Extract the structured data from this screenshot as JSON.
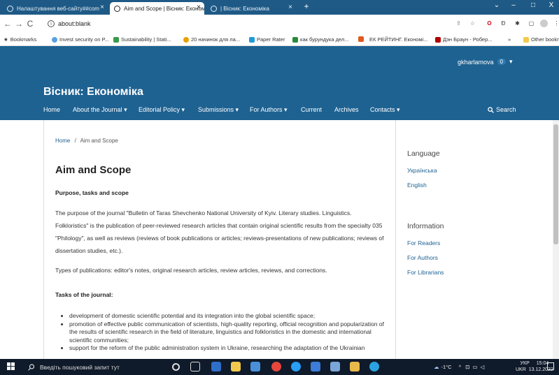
{
  "browser": {
    "tabs": [
      {
        "label": "Налаштування веб-сайту##com",
        "active": false
      },
      {
        "label": "Aim and Scope | Вісник: Економі",
        "active": true
      },
      {
        "label": "| Вісник: Економіка",
        "active": false
      }
    ],
    "new_tab": "+",
    "window_controls": {
      "minimize": "–",
      "maximize": "□",
      "close": "X"
    },
    "address": "about:blank",
    "bookmarks": [
      {
        "label": "Bookmarks",
        "color": "#1a73e8"
      },
      {
        "label": "Invest security on P...",
        "color": "#5aa0e0"
      },
      {
        "label": "Sustainability | Stati...",
        "color": "#3a9a4a"
      },
      {
        "label": "20 начинок для ла...",
        "color": "#e8a000"
      },
      {
        "label": "Paper Rater",
        "color": "#1e9bd7"
      },
      {
        "label": "как бурундука дел...",
        "color": "#2a8a3a"
      },
      {
        "label": "",
        "color": "#e05a20"
      },
      {
        "label": "ЕК РЕЙТИНГ. Економі...",
        "color": "#c0001f"
      },
      {
        "label": "Дэн Браун - Робер...",
        "color": "#b00000"
      }
    ],
    "bookmarks_more": "»",
    "other_bookmarks": "Other bookmarks"
  },
  "header": {
    "site_title": "Вісник: Економіка",
    "user": "gkharlamova",
    "notifications": "0",
    "nav": [
      {
        "label": "Home",
        "dropdown": false
      },
      {
        "label": "About the Journal",
        "dropdown": true
      },
      {
        "label": "Editorial Policy",
        "dropdown": true
      },
      {
        "label": "Submissions",
        "dropdown": true
      },
      {
        "label": "For Authors",
        "dropdown": true
      },
      {
        "label": "Current",
        "dropdown": false
      },
      {
        "label": "Archives",
        "dropdown": false
      },
      {
        "label": "Contacts",
        "dropdown": true
      }
    ],
    "search_label": "Search",
    "bg_color": "#1e6292"
  },
  "main": {
    "breadcrumb": {
      "home": "Home",
      "separator": "/",
      "current": "Aim and Scope"
    },
    "title": "Aim and Scope",
    "subtitle": "Purpose, tasks and scope",
    "para1": "The purpose of the journal \"Bulletin of Taras Shevchenko National University of Kyiv. Literary studies. Linguistics. Folkloristics\" is the publication of peer-reviewed research articles that contain original scientific results from the specialty 035 \"Philology\", as well as reviews (reviews of book publications or articles; reviews-presentations of new publications; reviews of dissertation studies, etc.).",
    "para2": "Types of publications: editor's notes, original research articles, review articles, reviews, and corrections.",
    "tasks_heading": "Tasks of the journal:",
    "tasks": [
      "development of domestic scientific potential and its integration into the global scientific space;",
      "promotion of effective public communication of scientists, high-quality reporting, official recognition and popularization of the results of scientific research in the field of literature, linguistics and folkloristics in the domestic and international scientific communities;",
      "support for the reform of the public administration system in Ukraine, researching the adaptation of the Ukrainian"
    ]
  },
  "sidebar": {
    "language_heading": "Language",
    "languages": [
      "Українська",
      "English"
    ],
    "information_heading": "Information",
    "information_links": [
      "For Readers",
      "For Authors",
      "For Librarians"
    ]
  },
  "taskbar": {
    "search_placeholder": "Введіть пошуковий запит тут",
    "weather": "-1°C",
    "lang_top": "УКР",
    "lang_bottom": "UKR",
    "time": "15:04",
    "date": "13.12.2022"
  }
}
